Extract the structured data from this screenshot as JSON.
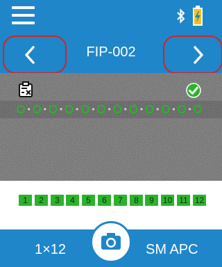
{
  "header": {
    "menu_icon": "hamburger-menu-icon",
    "bluetooth_icon": "bluetooth-icon",
    "battery_icon": "battery-charging-icon",
    "accent_color": "#1f86c9"
  },
  "nav": {
    "title": "FIP-002",
    "prev_icon": "chevron-left-icon",
    "next_icon": "chevron-right-icon",
    "highlight_color": "#d42323"
  },
  "inspection": {
    "report_icon": "report-clipboard-icon",
    "status_icon": "pass-check-icon",
    "status_color": "#2bb32b",
    "fiber_count": 12
  },
  "ports": {
    "items": [
      "1",
      "2",
      "3",
      "4",
      "5",
      "6",
      "7",
      "8",
      "9",
      "10",
      "11",
      "12"
    ],
    "color": "#2bb32b"
  },
  "footer": {
    "left_label": "1×12",
    "right_label": "SM APC",
    "capture_icon": "camera-icon"
  }
}
